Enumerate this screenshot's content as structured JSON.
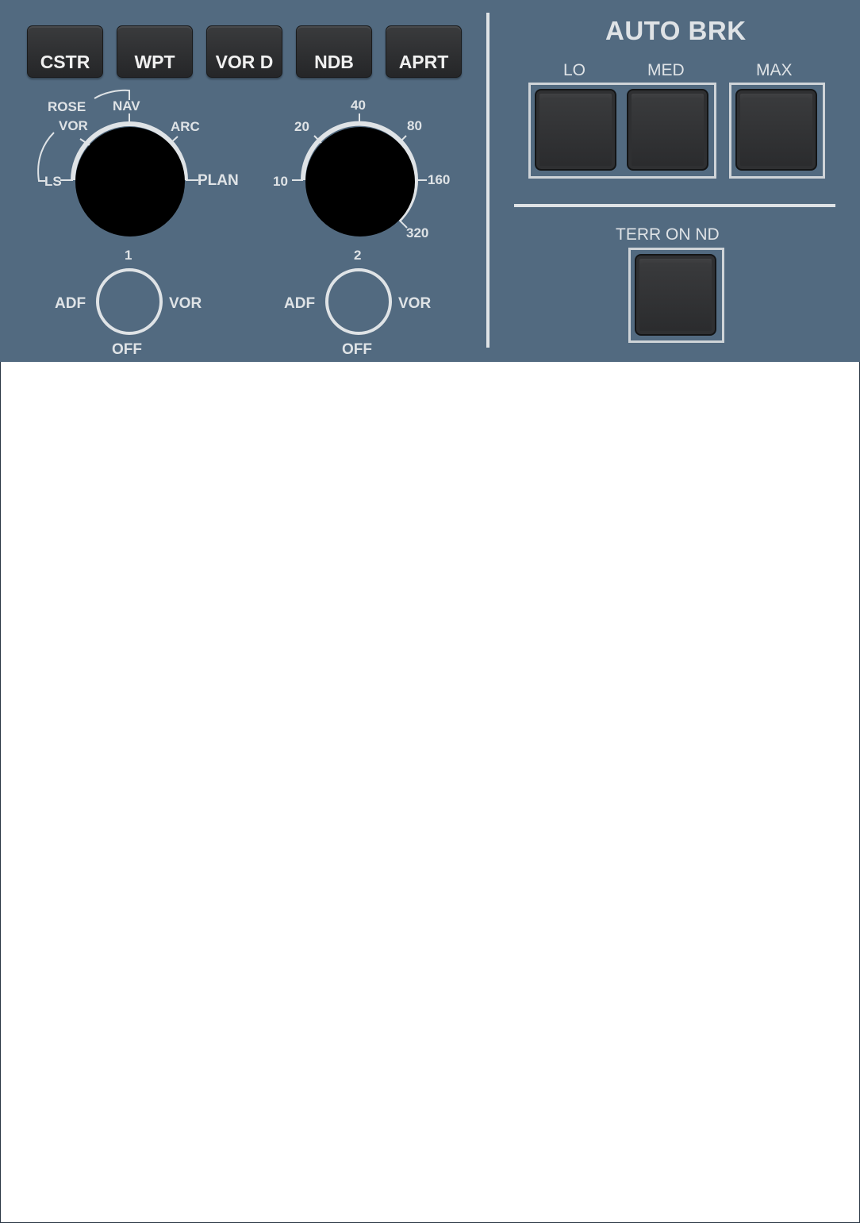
{
  "efis": {
    "buttons": {
      "cstr": "CSTR",
      "wpt": "WPT",
      "vord": "VOR D",
      "ndb": "NDB",
      "aprt": "APRT"
    },
    "mode": {
      "ls": "LS",
      "rose": "ROSE",
      "vor": "VOR",
      "nav": "NAV",
      "arc": "ARC",
      "plan": "PLAN"
    },
    "range": {
      "r10": "10",
      "r20": "20",
      "r40": "40",
      "r80": "80",
      "r160": "160",
      "r320": "320"
    },
    "nav1": {
      "num": "1",
      "adf": "ADF",
      "vor": "VOR",
      "off": "OFF"
    },
    "nav2": {
      "num": "2",
      "adf": "ADF",
      "vor": "VOR",
      "off": "OFF"
    }
  },
  "autobrk": {
    "title": "AUTO BRK",
    "lo": "LO",
    "med": "MED",
    "max": "MAX"
  },
  "terr": {
    "label": "TERR ON ND"
  }
}
